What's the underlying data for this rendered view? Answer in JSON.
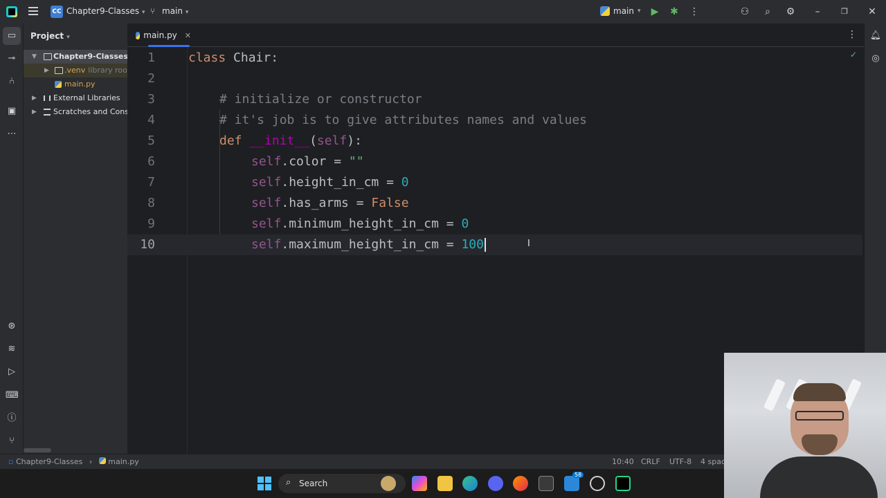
{
  "titlebar": {
    "project_badge": "CC",
    "project_name": "Chapter9-Classes",
    "branch": "main",
    "run_config": "main"
  },
  "project_panel": {
    "title": "Project",
    "items": [
      {
        "label": "Chapter9-Classes",
        "kind": "folder"
      },
      {
        "label": ".venv",
        "suffix": "library root",
        "kind": "folder"
      },
      {
        "label": "main.py",
        "kind": "python-file"
      },
      {
        "label": "External Libraries",
        "kind": "library"
      },
      {
        "label": "Scratches and Consoles",
        "kind": "scratch"
      }
    ]
  },
  "editor": {
    "tab_label": "main.py",
    "lines": [
      {
        "n": "1"
      },
      {
        "n": "2"
      },
      {
        "n": "3"
      },
      {
        "n": "4"
      },
      {
        "n": "5"
      },
      {
        "n": "6"
      },
      {
        "n": "7"
      },
      {
        "n": "8"
      },
      {
        "n": "9"
      },
      {
        "n": "10"
      }
    ],
    "code": {
      "l1_kw": "class",
      "l1_rest": " Chair:",
      "l3": "# initialize or constructor",
      "l4": "# it's job is to give attributes names and values",
      "l5_kw": "def",
      "l5_fn": "__init__",
      "l5_open": "(",
      "l5_param": "self",
      "l5_close": "):",
      "l6_self": "self",
      "l6_attr": ".color = ",
      "l6_val": "\"\"",
      "l7_self": "self",
      "l7_attr": ".height_in_cm = ",
      "l7_val": "0",
      "l8_self": "self",
      "l8_attr": ".has_arms = ",
      "l8_val": "False",
      "l9_self": "self",
      "l9_attr": ".minimum_height_in_cm = ",
      "l9_val": "0",
      "l10_self": "self",
      "l10_attr": ".maximum_height_in_cm = ",
      "l10_val": "100"
    }
  },
  "statusbar": {
    "breadcrumb_project": "Chapter9-Classes",
    "breadcrumb_file": "main.py",
    "position": "10:40",
    "line_ending": "CRLF",
    "encoding": "UTF-8",
    "indent": "4 spac"
  },
  "taskbar": {
    "search_label": "Search",
    "badge_count": "58"
  }
}
